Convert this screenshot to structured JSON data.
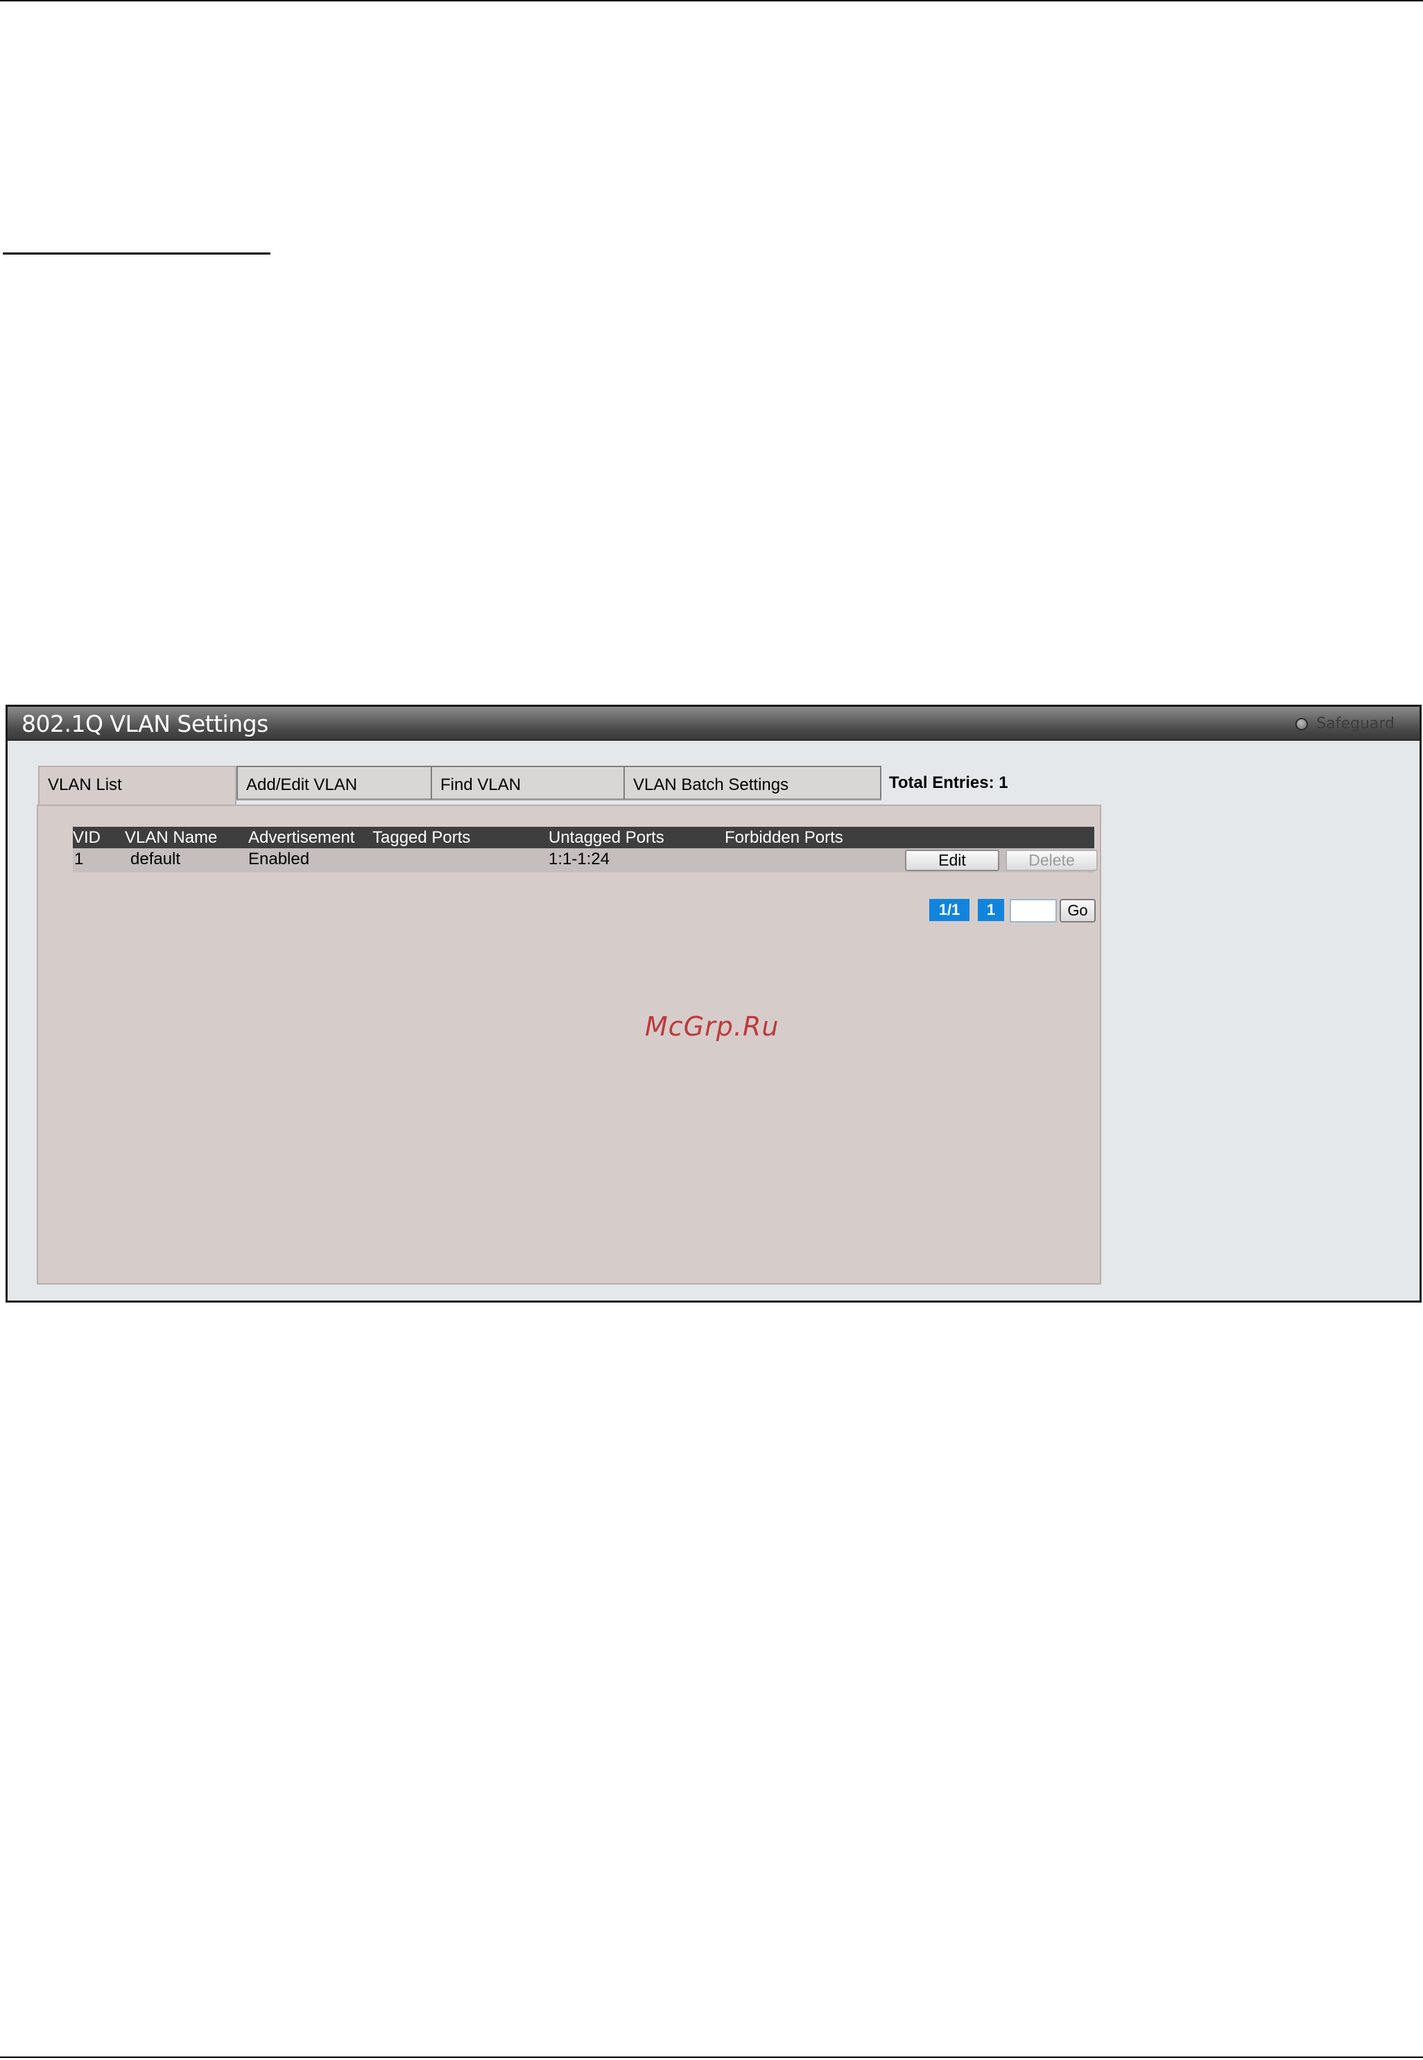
{
  "window": {
    "title": "802.1Q VLAN Settings",
    "safeguard_label": "Safeguard"
  },
  "tabs": [
    {
      "label": "VLAN List",
      "active": true
    },
    {
      "label": "Add/Edit VLAN",
      "active": false
    },
    {
      "label": "Find VLAN",
      "active": false
    },
    {
      "label": "VLAN Batch Settings",
      "active": false
    }
  ],
  "total_entries": "Total Entries: 1",
  "table": {
    "columns": [
      "VID",
      "VLAN Name",
      "Advertisement",
      "Tagged Ports",
      "Untagged Ports",
      "Forbidden Ports"
    ],
    "rows": [
      {
        "vid": "1",
        "name": "default",
        "advertisement": "Enabled",
        "tagged": "",
        "untagged": "1:1-1:24",
        "forbidden": ""
      }
    ],
    "edit_label": "Edit",
    "delete_label": "Delete"
  },
  "pager": {
    "page_of": "1/1",
    "current": "1",
    "goto_value": "",
    "go_label": "Go"
  },
  "watermark": "McGrp.Ru",
  "colors": {
    "accent": "#1185dd",
    "panel": "#d6cdcb",
    "header": "#3e3e3e",
    "watermark": "#c0393b"
  }
}
